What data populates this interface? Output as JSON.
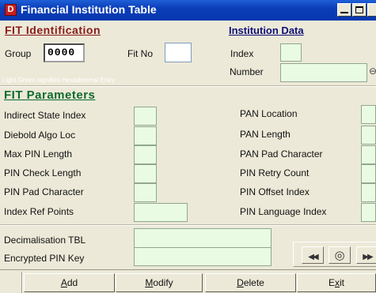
{
  "window": {
    "title": "Financial Institution Table",
    "app_icon_letter": "D"
  },
  "fit_identification": {
    "heading": "FIT Identification",
    "group_label": "Group",
    "group_value": "0000",
    "fitno_label": "Fit No",
    "fitno_value": "",
    "hint": "Light Green signifies Hexadecimal Entry"
  },
  "institution_data": {
    "heading": "Institution Data",
    "index_label": "Index",
    "index_value": "",
    "number_label": "Number",
    "number_value": ""
  },
  "fit_parameters": {
    "heading": "FIT Parameters",
    "left": [
      {
        "label": "Indirect State Index",
        "value": ""
      },
      {
        "label": "Diebold Algo Loc",
        "value": ""
      },
      {
        "label": "Max PIN Length",
        "value": ""
      },
      {
        "label": "PIN Check Length",
        "value": ""
      },
      {
        "label": "PIN Pad Character",
        "value": ""
      },
      {
        "label": "Index Ref Points",
        "value": ""
      }
    ],
    "right": [
      {
        "label": "PAN Location",
        "value": ""
      },
      {
        "label": "PAN Length",
        "value": ""
      },
      {
        "label": "PAN Pad Character",
        "value": ""
      },
      {
        "label": "PIN Retry Count",
        "value": ""
      },
      {
        "label": "PIN Offset Index",
        "value": ""
      },
      {
        "label": "PIN Language Index",
        "value": ""
      }
    ],
    "decimalisation_label": "Decimalisation TBL",
    "decimalisation_value": "",
    "encrypted_pin_label": "Encrypted PIN Key",
    "encrypted_pin_value": ""
  },
  "navigation": {
    "first_glyph": "◀◀",
    "view_glyph": "◎",
    "next_glyph": "▶▶"
  },
  "buttons": {
    "add": {
      "mnemonic": "A",
      "rest": "dd"
    },
    "modify": {
      "mnemonic": "M",
      "rest": "odify"
    },
    "delete": {
      "mnemonic": "D",
      "rest": "elete"
    },
    "exit": {
      "pre": "E",
      "mnemonic": "x",
      "rest": "it"
    }
  },
  "colors": {
    "titlebar": "#0a3eb8",
    "hex_field_bg": "#eafbe4",
    "fit_identification_heading": "#8b1a1a",
    "fit_parameters_heading": "#0f6a2e",
    "institution_data_heading": "#10107a"
  }
}
